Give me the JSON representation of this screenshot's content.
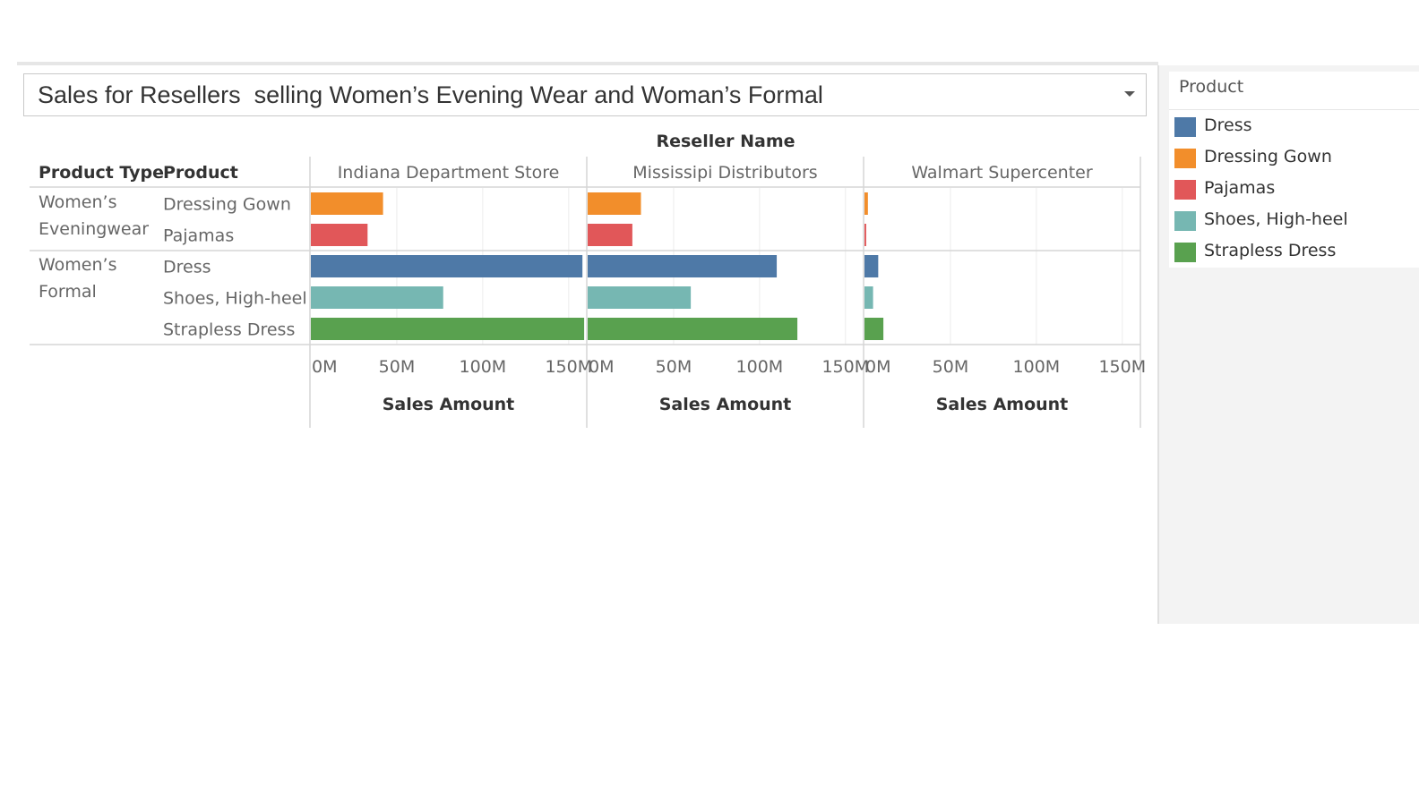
{
  "title": "Sales for Resellers  selling Women’s Evening Wear and Woman’s Formal",
  "legend": {
    "title": "Product",
    "items": [
      {
        "label": "Dress",
        "color": "#4e79a7"
      },
      {
        "label": "Dressing Gown",
        "color": "#f28e2b"
      },
      {
        "label": "Pajamas",
        "color": "#e15759"
      },
      {
        "label": "Shoes, High-heel",
        "color": "#76b7b2"
      },
      {
        "label": "Strapless Dress",
        "color": "#59a14f"
      }
    ]
  },
  "chart_data": {
    "type": "bar",
    "orientation": "horizontal",
    "column_group_label": "Reseller Name",
    "row_headers": [
      "Product Type",
      "Product"
    ],
    "xlabel": "Sales Amount",
    "xlim": [
      0,
      160
    ],
    "x_ticks": [
      "0M",
      "50M",
      "100M",
      "150M"
    ],
    "grid": true,
    "legend_position": "right",
    "panels": [
      "Indiana Department Store",
      "Mississipi Distributors",
      "Walmart Supercenter"
    ],
    "groups": [
      {
        "type": "Women’s Eveningwear",
        "type_lines": [
          "Women’s",
          "Eveningwear"
        ],
        "products": [
          "Dressing Gown",
          "Pajamas"
        ]
      },
      {
        "type": "Women’s Formal",
        "type_lines": [
          "Women’s",
          "Formal"
        ],
        "products": [
          "Dress",
          "Shoes, High-heel",
          "Strapless Dress"
        ]
      }
    ],
    "series": [
      {
        "name": "Dressing Gown",
        "values": [
          42,
          31,
          2
        ]
      },
      {
        "name": "Pajamas",
        "values": [
          33,
          26,
          1
        ]
      },
      {
        "name": "Dress",
        "values": [
          158,
          110,
          8
        ]
      },
      {
        "name": "Shoes, High-heel",
        "values": [
          77,
          60,
          5
        ]
      },
      {
        "name": "Strapless Dress",
        "values": [
          159,
          122,
          11
        ]
      }
    ]
  }
}
